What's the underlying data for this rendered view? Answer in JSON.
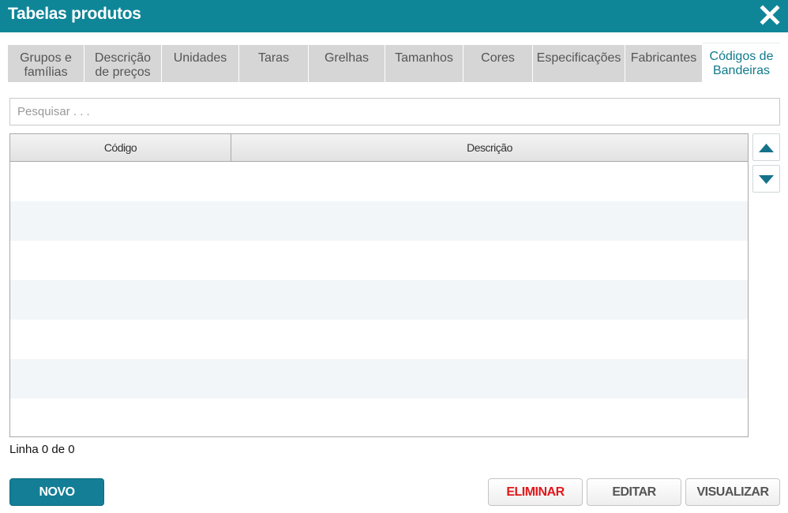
{
  "window": {
    "title": "Tabelas produtos",
    "close_icon": "close-icon"
  },
  "tabs": [
    {
      "label": "Grupos e\nfamílias",
      "active": false
    },
    {
      "label": "Descrição\nde preços",
      "active": false
    },
    {
      "label": "Unidades",
      "active": false
    },
    {
      "label": "Taras",
      "active": false
    },
    {
      "label": "Grelhas",
      "active": false
    },
    {
      "label": "Tamanhos",
      "active": false
    },
    {
      "label": "Cores",
      "active": false
    },
    {
      "label": "Especificações",
      "active": false
    },
    {
      "label": "Fabricantes",
      "active": false
    },
    {
      "label": "Códigos de\nBandeiras",
      "active": true
    }
  ],
  "search": {
    "placeholder": "Pesquisar . . .",
    "value": ""
  },
  "grid": {
    "columns": [
      "Código",
      "Descrição"
    ],
    "rows": []
  },
  "scroll": {
    "up_icon": "triangle-up-icon",
    "down_icon": "triangle-down-icon"
  },
  "status": {
    "text": "Linha 0 de 0"
  },
  "buttons": {
    "novo": "NOVO",
    "eliminar": "ELIMINAR",
    "editar": "EDITAR",
    "visualizar": "VISUALIZAR"
  },
  "colors": {
    "accent": "#0f8698",
    "active_tab_text": "#0f7a8c",
    "danger": "#e0181b"
  }
}
